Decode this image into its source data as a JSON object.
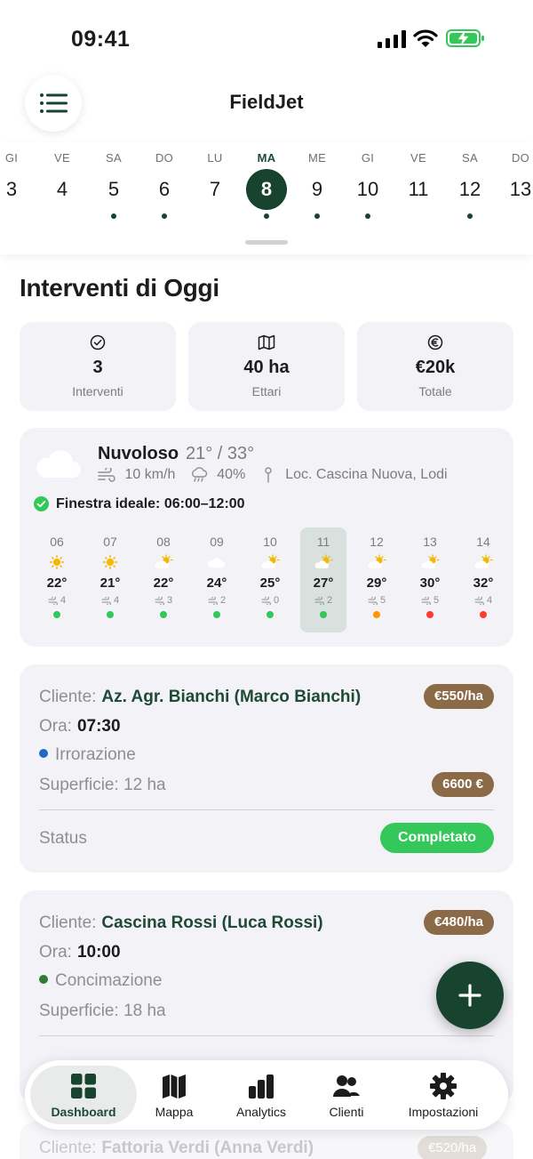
{
  "status_bar": {
    "time": "09:41"
  },
  "header": {
    "title": "FieldJet"
  },
  "days": [
    {
      "name": "GI",
      "num": "3",
      "dot": false
    },
    {
      "name": "VE",
      "num": "4",
      "dot": false
    },
    {
      "name": "SA",
      "num": "5",
      "dot": true
    },
    {
      "name": "DO",
      "num": "6",
      "dot": true
    },
    {
      "name": "LU",
      "num": "7",
      "dot": false
    },
    {
      "name": "MA",
      "num": "8",
      "dot": true,
      "selected": true
    },
    {
      "name": "ME",
      "num": "9",
      "dot": true
    },
    {
      "name": "GI",
      "num": "10",
      "dot": true
    },
    {
      "name": "VE",
      "num": "11",
      "dot": false
    },
    {
      "name": "SA",
      "num": "12",
      "dot": true
    },
    {
      "name": "DO",
      "num": "13",
      "dot": false
    }
  ],
  "section_title": "Interventi di Oggi",
  "stats": [
    {
      "icon": "check-circle-icon",
      "value": "3",
      "label": "Interventi"
    },
    {
      "icon": "map-icon",
      "value": "40 ha",
      "label": "Ettari"
    },
    {
      "icon": "euro-icon",
      "value": "€20k",
      "label": "Totale"
    }
  ],
  "weather": {
    "condition": "Nuvoloso",
    "temps": "21° / 33°",
    "wind": "10 km/h",
    "rain": "40%",
    "location": "Loc. Cascina Nuova, Lodi",
    "window": "Finestra ideale: 06:00–12:00",
    "hours": [
      {
        "t": "06",
        "icon": "sun",
        "temp": "22°",
        "wind": "4",
        "level": "green"
      },
      {
        "t": "07",
        "icon": "sun",
        "temp": "21°",
        "wind": "4",
        "level": "green"
      },
      {
        "t": "08",
        "icon": "partly-cloudy",
        "temp": "22°",
        "wind": "3",
        "level": "green"
      },
      {
        "t": "09",
        "icon": "cloud",
        "temp": "24°",
        "wind": "2",
        "level": "green"
      },
      {
        "t": "10",
        "icon": "partly-cloudy",
        "temp": "25°",
        "wind": "0",
        "level": "green"
      },
      {
        "t": "11",
        "icon": "partly-cloudy",
        "temp": "27°",
        "wind": "2",
        "level": "green",
        "current": true
      },
      {
        "t": "12",
        "icon": "partly-cloudy",
        "temp": "29°",
        "wind": "5",
        "level": "orange"
      },
      {
        "t": "13",
        "icon": "partly-cloudy",
        "temp": "30°",
        "wind": "5",
        "level": "red"
      },
      {
        "t": "14",
        "icon": "partly-cloudy",
        "temp": "32°",
        "wind": "4",
        "level": "red"
      }
    ]
  },
  "labels": {
    "cliente": "Cliente:",
    "ora": "Ora:",
    "superficie": "Superficie:",
    "status": "Status"
  },
  "jobs": [
    {
      "client": "Az. Agr. Bianchi (Marco Bianchi)",
      "rate": "€550/ha",
      "time": "07:30",
      "type": "Irrorazione",
      "type_color": "#1f6bc4",
      "area": "12 ha",
      "total": "6600 €",
      "status": "Completato"
    },
    {
      "client": "Cascina Rossi (Luca Rossi)",
      "rate": "€480/ha",
      "time": "10:00",
      "type": "Concimazione",
      "type_color": "#2e7d32",
      "area": "18 ha"
    },
    {
      "client": "Fattoria Verdi (Anna Verdi)",
      "rate": "€520/ha"
    }
  ],
  "tabs": [
    {
      "label": "Dashboard",
      "icon": "dashboard-grid-icon",
      "active": true
    },
    {
      "label": "Mappa",
      "icon": "map-icon"
    },
    {
      "label": "Analytics",
      "icon": "bar-chart-icon"
    },
    {
      "label": "Clienti",
      "icon": "users-icon"
    },
    {
      "label": "Impostazioni",
      "icon": "gear-icon"
    }
  ],
  "colors": {
    "primary": "#17432f",
    "accent_brown": "#8b6a48",
    "success": "#34c759",
    "warning": "#ff9500",
    "danger": "#ff3b30",
    "card": "#f2f2f7"
  }
}
